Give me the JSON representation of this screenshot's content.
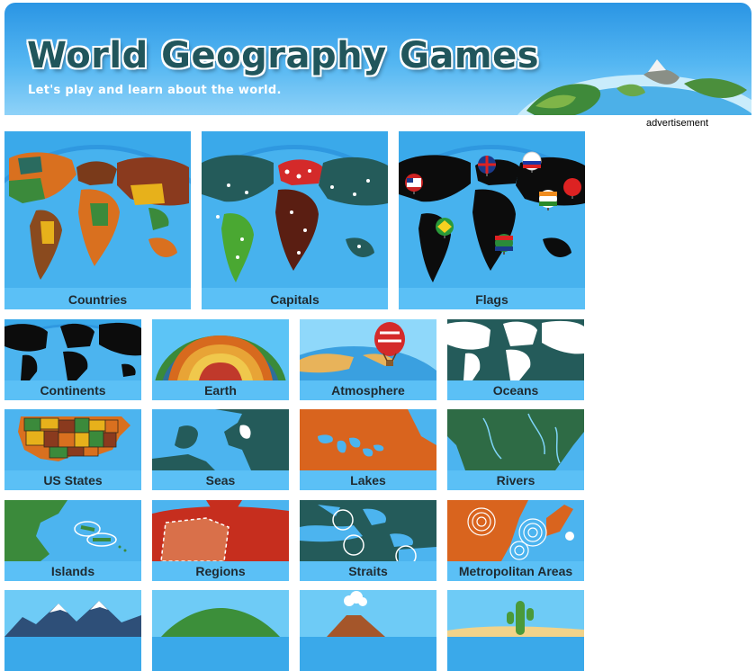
{
  "header": {
    "title": "World Geography Games",
    "subtitle": "Let's play and learn about the world."
  },
  "ad": {
    "label": "advertisement"
  },
  "games": {
    "row1": [
      {
        "label": "Countries",
        "icon": "world-countries-map-icon"
      },
      {
        "label": "Capitals",
        "icon": "world-capitals-map-icon"
      },
      {
        "label": "Flags",
        "icon": "world-flags-map-icon"
      }
    ],
    "row2": [
      {
        "label": "Continents",
        "icon": "continents-map-icon"
      },
      {
        "label": "Earth",
        "icon": "earth-layers-icon"
      },
      {
        "label": "Atmosphere",
        "icon": "hot-air-balloon-icon"
      },
      {
        "label": "Oceans",
        "icon": "oceans-map-icon"
      }
    ],
    "row3": [
      {
        "label": "US States",
        "icon": "us-states-map-icon"
      },
      {
        "label": "Seas",
        "icon": "seas-map-icon"
      },
      {
        "label": "Lakes",
        "icon": "lakes-map-icon"
      },
      {
        "label": "Rivers",
        "icon": "rivers-map-icon"
      }
    ],
    "row4": [
      {
        "label": "Islands",
        "icon": "islands-map-icon"
      },
      {
        "label": "Regions",
        "icon": "regions-map-icon"
      },
      {
        "label": "Straits",
        "icon": "straits-map-icon"
      },
      {
        "label": "Metropolitan Areas",
        "icon": "metropolitan-areas-map-icon"
      }
    ],
    "row5": [
      {
        "label": "",
        "icon": "mountains-icon"
      },
      {
        "label": "",
        "icon": "hills-icon"
      },
      {
        "label": "",
        "icon": "volcano-icon"
      },
      {
        "label": "",
        "icon": "desert-cactus-icon"
      }
    ]
  },
  "colors": {
    "tile_bg": "#3aa9ea",
    "caption_bg": "#5bc0f6",
    "land_dark": "#245b5a",
    "land_orange": "#d9701f",
    "title_text": "#21565c"
  }
}
